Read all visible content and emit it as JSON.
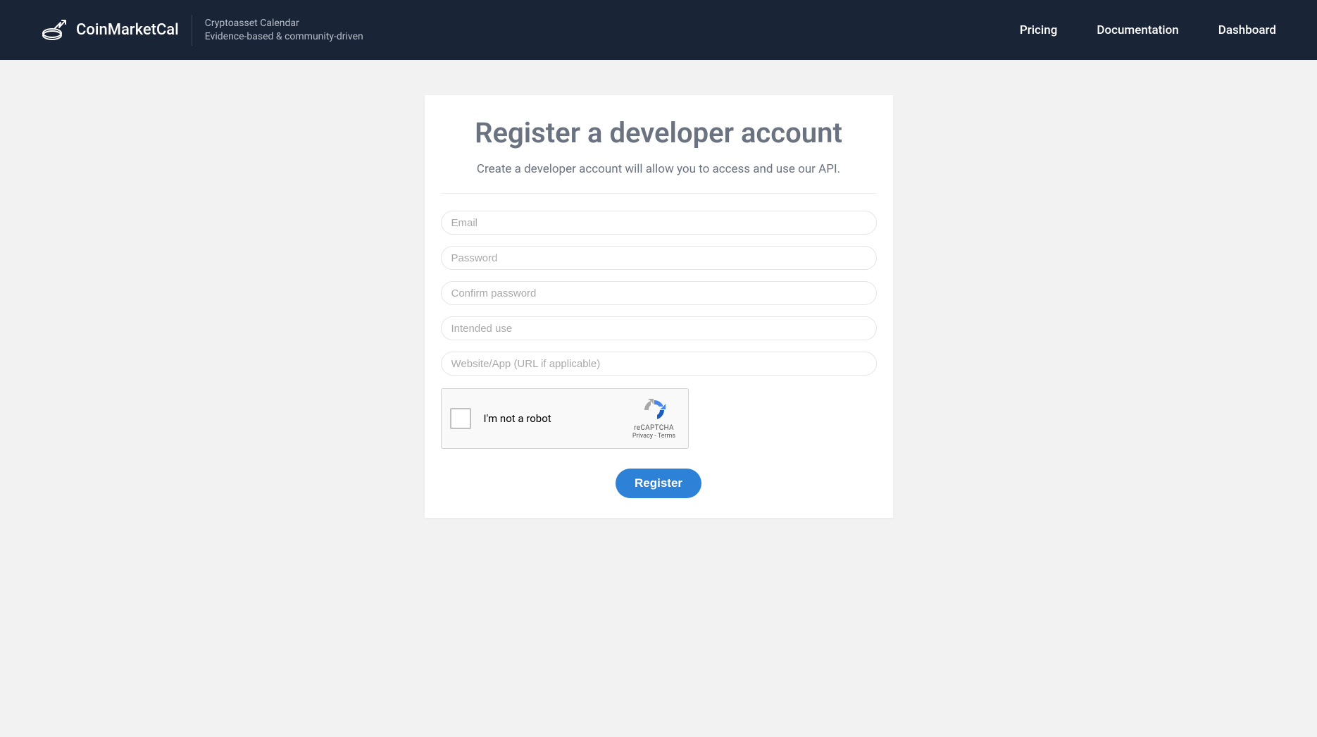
{
  "header": {
    "logo_text": "CoinMarketCal",
    "tagline_top": "Cryptoasset Calendar",
    "tagline_bottom": "Evidence-based & community-driven"
  },
  "nav": {
    "pricing": "Pricing",
    "documentation": "Documentation",
    "dashboard": "Dashboard"
  },
  "card": {
    "title": "Register a developer account",
    "subtitle": "Create a developer account will allow you to access and use our API."
  },
  "form": {
    "email_placeholder": "Email",
    "password_placeholder": "Password",
    "confirm_password_placeholder": "Confirm password",
    "intended_use_placeholder": "Intended use",
    "website_placeholder": "Website/App (URL if applicable)",
    "register_label": "Register"
  },
  "recaptcha": {
    "label": "I'm not a robot",
    "brand": "reCAPTCHA",
    "privacy": "Privacy",
    "terms": "Terms"
  }
}
